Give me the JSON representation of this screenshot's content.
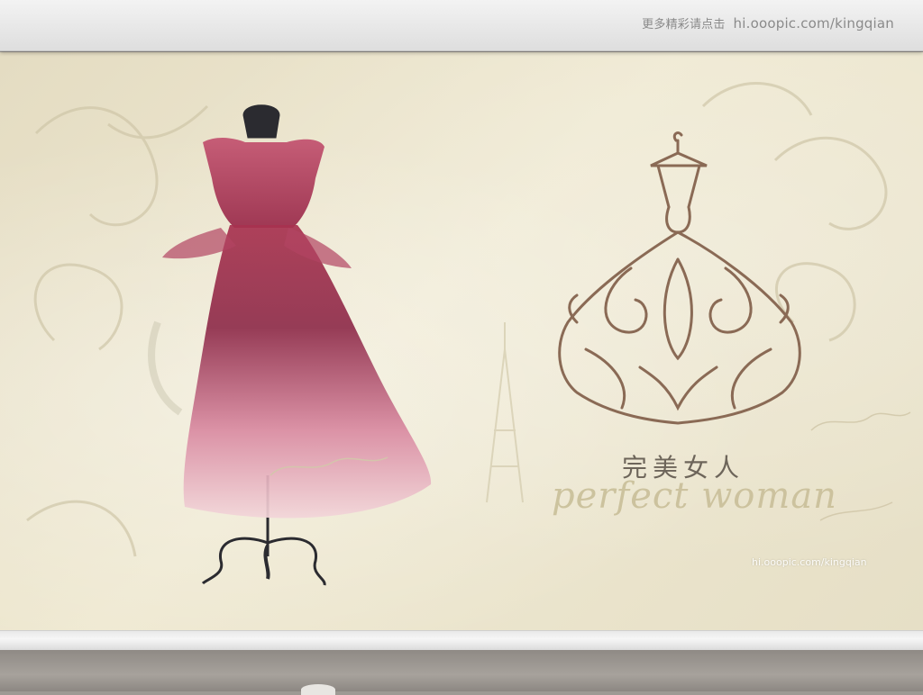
{
  "header": {
    "prefix": "更多精彩请点击",
    "link": "hi.ooopic.com/kingqian"
  },
  "artwork": {
    "title_cn": "完美女人",
    "title_en": "perfect woman",
    "watermark": "hi.ooopic.com/kingqian",
    "colors": {
      "background": "#ebe4cc",
      "dress": "#a23a5a",
      "ornament_dress": "#8a6a55",
      "mannequin": "#2b2b30"
    }
  }
}
